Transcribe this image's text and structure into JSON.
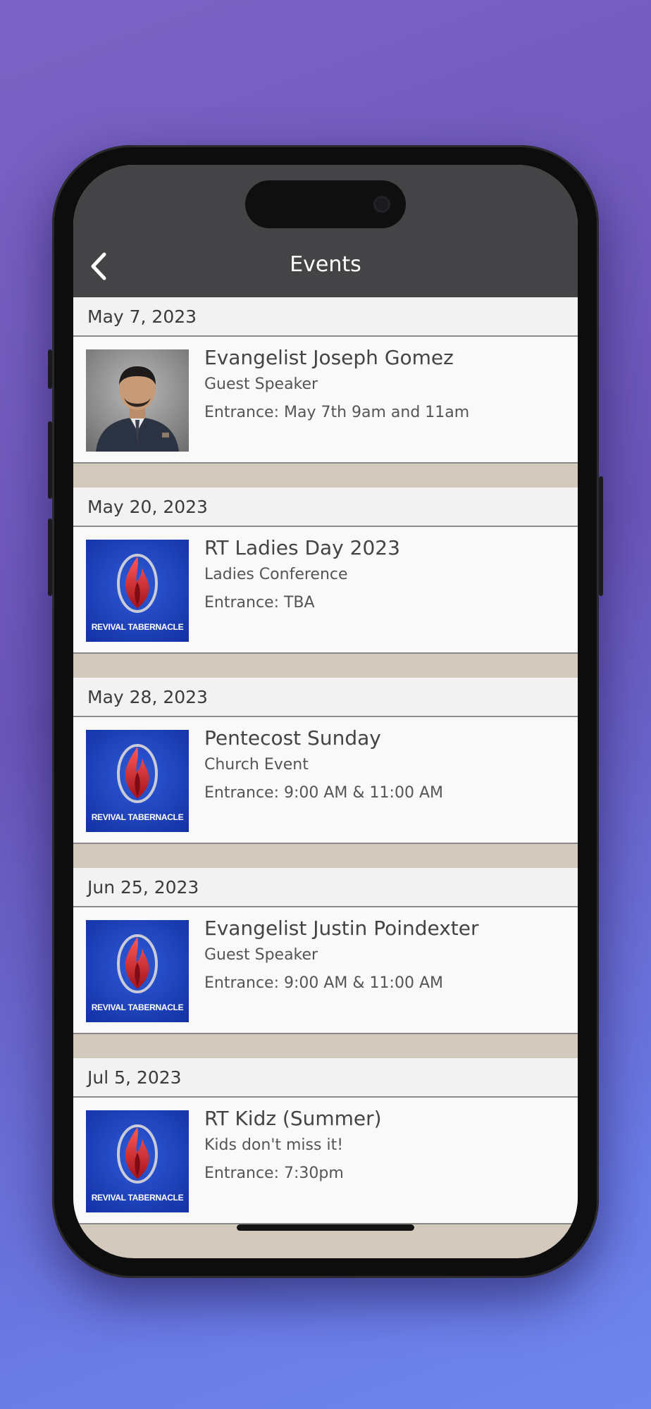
{
  "header": {
    "title": "Events",
    "back_icon": "chevron-left-icon"
  },
  "colors": {
    "navbar": "#444446",
    "date_row_bg": "#f2f2f2",
    "card_bg": "#f9f9f9",
    "separator": "#d3c9bd",
    "logo_blue": "#1c3fb7"
  },
  "events": [
    {
      "date": "May 7, 2023",
      "title": "Evangelist Joseph Gomez",
      "subtitle": "Guest Speaker",
      "entrance": "Entrance: May 7th 9am and 11am",
      "image": "speaker-photo"
    },
    {
      "date": "May 20, 2023",
      "title": "RT Ladies Day 2023",
      "subtitle": "Ladies Conference",
      "entrance": "Entrance: TBA",
      "image": "revival-tabernacle-logo"
    },
    {
      "date": "May 28, 2023",
      "title": "Pentecost Sunday",
      "subtitle": "Church Event",
      "entrance": "Entrance: 9:00 AM & 11:00 AM",
      "image": "revival-tabernacle-logo"
    },
    {
      "date": "Jun 25, 2023",
      "title": "Evangelist Justin Poindexter",
      "subtitle": "Guest Speaker",
      "entrance": "Entrance: 9:00 AM & 11:00 AM",
      "image": "revival-tabernacle-logo"
    },
    {
      "date": "Jul 5, 2023",
      "title": "RT Kidz (Summer)",
      "subtitle": "Kids don't miss it!",
      "entrance": "Entrance: 7:30pm",
      "image": "revival-tabernacle-logo"
    }
  ],
  "logo": {
    "text": "REVIVAL TABERNACLE"
  }
}
